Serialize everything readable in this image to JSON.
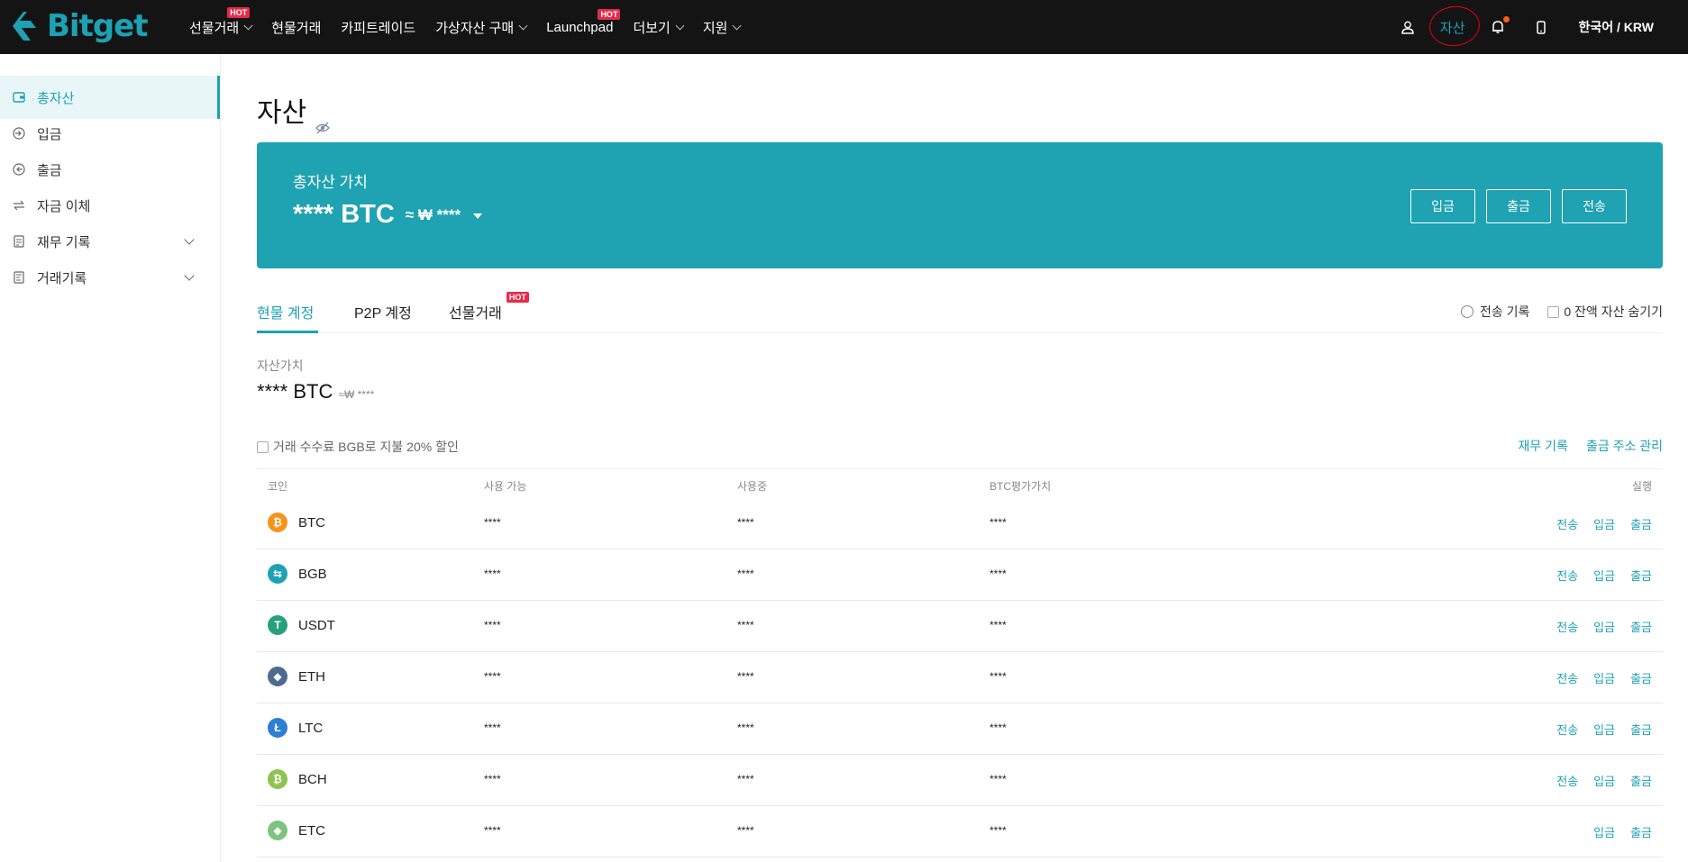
{
  "nav": {
    "logo_text": "Bitget",
    "items": [
      {
        "label": "선물거래",
        "hot": "HOT",
        "chevron": true
      },
      {
        "label": "현물거래",
        "hot": "",
        "chevron": false
      },
      {
        "label": "카피트레이드",
        "hot": "",
        "chevron": false
      },
      {
        "label": "가상자산 구매",
        "hot": "",
        "chevron": true
      },
      {
        "label": "Launchpad",
        "hot": "HOT",
        "chevron": false
      },
      {
        "label": "더보기",
        "hot": "",
        "chevron": true
      },
      {
        "label": "지원",
        "hot": "",
        "chevron": true
      }
    ],
    "asset_label": "자산",
    "language": "한국어 / KRW"
  },
  "sidebar": {
    "items": [
      {
        "label": "총자산",
        "icon": "wallet-icon",
        "active": true,
        "expandable": false
      },
      {
        "label": "입금",
        "icon": "deposit-icon",
        "active": false,
        "expandable": false
      },
      {
        "label": "출금",
        "icon": "withdraw-icon",
        "active": false,
        "expandable": false
      },
      {
        "label": "자금 이체",
        "icon": "transfer-icon",
        "active": false,
        "expandable": false
      },
      {
        "label": "재무 기록",
        "icon": "record-icon",
        "active": false,
        "expandable": true
      },
      {
        "label": "거래기록",
        "icon": "trade-record-icon",
        "active": false,
        "expandable": true
      }
    ]
  },
  "page": {
    "title": "자산"
  },
  "banner": {
    "label": "총자산 가치",
    "value": "**** BTC",
    "approx": "≈ ₩ ****",
    "buttons": [
      "입금",
      "출금",
      "전송"
    ]
  },
  "tabs": {
    "items": [
      {
        "label": "현물 계정",
        "hot": ""
      },
      {
        "label": "P2P 계정",
        "hot": ""
      },
      {
        "label": "선물거래",
        "hot": "HOT"
      }
    ],
    "history": "전송 기록",
    "hide_zero": "0 잔액 자산 숨기기"
  },
  "account": {
    "label": "자산가치",
    "value": "**** BTC",
    "approx": "≈₩ ****",
    "fee_option": "거래 수수료 BGB로 지불 20% 할인",
    "links": [
      "재무 기록",
      "출금 주소 관리"
    ]
  },
  "table": {
    "headers": [
      "코인",
      "사용 가능",
      "사용중",
      "BTC평가가치",
      "실행"
    ],
    "rows": [
      {
        "coin": "BTC",
        "color": "#f7931a",
        "glyph": "₿",
        "available": "****",
        "in_use": "****",
        "btc_value": "****",
        "actions": [
          "전송",
          "입금",
          "출금"
        ]
      },
      {
        "coin": "BGB",
        "color": "#1da2b4",
        "glyph": "⇆",
        "available": "****",
        "in_use": "****",
        "btc_value": "****",
        "actions": [
          "전송",
          "입금",
          "출금"
        ]
      },
      {
        "coin": "USDT",
        "color": "#26a17b",
        "glyph": "T",
        "available": "****",
        "in_use": "****",
        "btc_value": "****",
        "actions": [
          "전송",
          "입금",
          "출금"
        ]
      },
      {
        "coin": "ETH",
        "color": "#4f6a8f",
        "glyph": "◆",
        "available": "****",
        "in_use": "****",
        "btc_value": "****",
        "actions": [
          "전송",
          "입금",
          "출금"
        ]
      },
      {
        "coin": "LTC",
        "color": "#2d7fd3",
        "glyph": "Ł",
        "available": "****",
        "in_use": "****",
        "btc_value": "****",
        "actions": [
          "전송",
          "입금",
          "출금"
        ]
      },
      {
        "coin": "BCH",
        "color": "#8dc351",
        "glyph": "₿",
        "available": "****",
        "in_use": "****",
        "btc_value": "****",
        "actions": [
          "전송",
          "입금",
          "출금"
        ]
      },
      {
        "coin": "ETC",
        "color": "#7cc47f",
        "glyph": "◆",
        "available": "****",
        "in_use": "****",
        "btc_value": "****",
        "actions": [
          "입금",
          "출금"
        ]
      }
    ]
  },
  "colors": {
    "accent": "#1da2b4",
    "nav_bg": "#141414",
    "hot": "#e62b4a"
  }
}
